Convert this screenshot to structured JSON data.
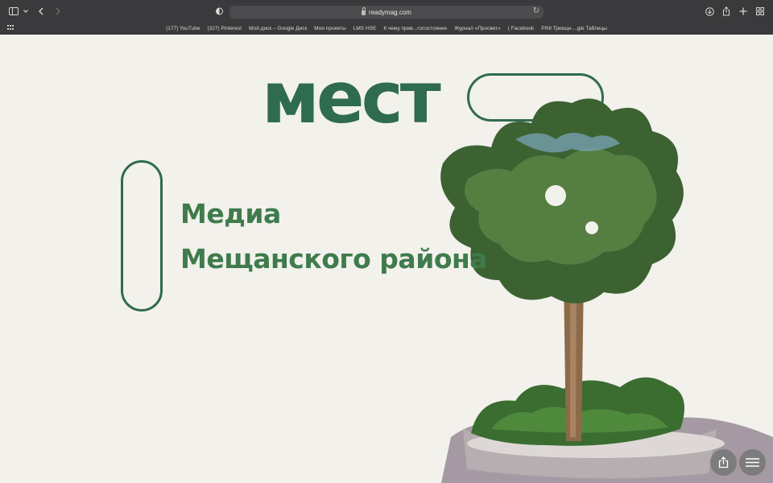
{
  "browser": {
    "url": "readymag.com",
    "icons": {
      "sidebar": "sidebar-icon",
      "back": "chevron-left-icon",
      "forward": "chevron-right-icon",
      "privacy": "shield-icon",
      "reload": "reload-icon",
      "download": "download-icon",
      "share": "share-icon",
      "new_tab": "plus-icon",
      "tab_overview": "tab-grid-icon"
    },
    "bookmarks": [
      "(177) YouTube",
      "(327) Pinterest",
      "Мой диск – Google Диск",
      "Мои проекты",
      "LMS HSE",
      "К чему прив...госостояние",
      "Журнал «Просвет»",
      "( Facebook",
      "PINI Трекщн-...gle Таблицы"
    ]
  },
  "page": {
    "brand": "мест",
    "subtitle_line1": "Медиа",
    "subtitle_line2": "Мещанского района",
    "accent_color": "#2f6b4f",
    "text_color": "#3f7b4c",
    "background_color": "#f2f1ec",
    "buttons": {
      "share_icon": "share-icon",
      "menu_icon": "menu-icon"
    }
  }
}
